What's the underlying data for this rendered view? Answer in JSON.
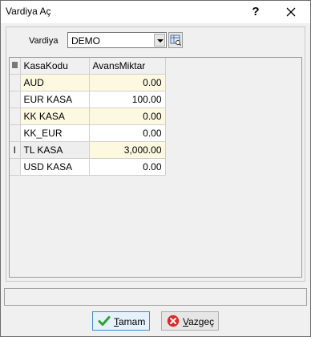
{
  "window": {
    "title": "Vardiya Aç",
    "help_label": "?",
    "close_icon": "close-icon"
  },
  "form": {
    "vardiya_label": "Vardiya",
    "vardiya_value": "DEMO"
  },
  "table": {
    "columns": [
      "KasaKodu",
      "AvansMiktar"
    ],
    "rows": [
      {
        "code": "AUD",
        "amount": "0.00",
        "indicator": ""
      },
      {
        "code": "EUR KASA",
        "amount": "100.00",
        "indicator": ""
      },
      {
        "code": "KK KASA",
        "amount": "0.00",
        "indicator": ""
      },
      {
        "code": "KK_EUR",
        "amount": "0.00",
        "indicator": ""
      },
      {
        "code": "TL KASA",
        "amount": "3,000.00",
        "indicator": "I"
      },
      {
        "code": "USD KASA",
        "amount": "0.00",
        "indicator": ""
      }
    ]
  },
  "buttons": {
    "ok_first": "T",
    "ok_rest": "amam",
    "cancel_first": "V",
    "cancel_rest": "azgeç"
  },
  "colors": {
    "row_alt": "#fdf9e1",
    "ok_border": "#4b89c9",
    "ok_icon": "#2fa12f",
    "cancel_icon": "#d92b2b"
  }
}
